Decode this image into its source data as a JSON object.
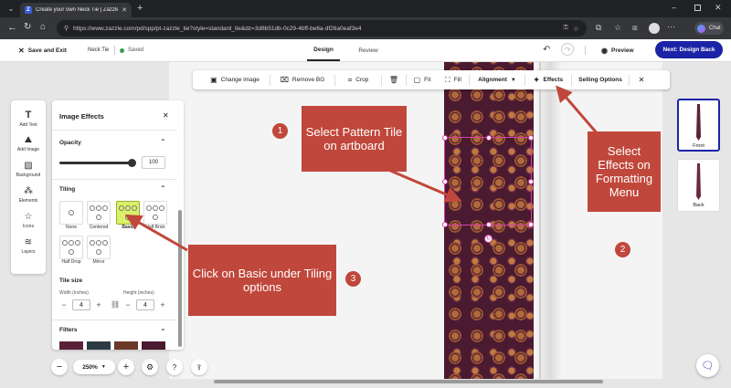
{
  "browser": {
    "tab_title": "Create your own Neck Tie | Zazzle",
    "url": "https://www.zazzle.com/pd/spp/pt-zazzle_tie?style=standard_tie&dz=3d8b51db-0c29-4bff-be6a-df26a0eaf3e4",
    "chat_label": "Chat"
  },
  "appbar": {
    "save_exit": "Save and Exit",
    "product": "Neck Tie",
    "saved": "Saved",
    "tab_design": "Design",
    "tab_review": "Review",
    "preview": "Preview",
    "next": "Next: Design Back"
  },
  "toolbar": {
    "change_image": "Change image",
    "remove_bg": "Remove BG",
    "crop": "Crop",
    "fit": "Fit",
    "fill": "Fill",
    "alignment": "Alignment",
    "effects": "Effects",
    "selling_options": "Selling Options"
  },
  "sidebar": {
    "items": [
      {
        "label": "Add Text"
      },
      {
        "label": "Add Image"
      },
      {
        "label": "Background"
      },
      {
        "label": "Elements"
      },
      {
        "label": "Icons"
      },
      {
        "label": "Layers"
      }
    ]
  },
  "panel": {
    "title": "Image Effects",
    "opacity_label": "Opacity",
    "opacity_value": "100",
    "opacity_level": 1.0,
    "tiling_label": "Tiling",
    "tiling_options": [
      {
        "label": "None"
      },
      {
        "label": "Centered"
      },
      {
        "label": "Basic"
      },
      {
        "label": "Half Brick"
      },
      {
        "label": "Half Drop"
      },
      {
        "label": "Mirror"
      }
    ],
    "tile_size_label": "Tile size",
    "width_label": "Width (inches)",
    "width_value": "4",
    "height_label": "Height (inches)",
    "height_value": "4",
    "filters_label": "Filters"
  },
  "zoom": {
    "value": "250%"
  },
  "views": [
    {
      "label": "Front"
    },
    {
      "label": "Back"
    }
  ],
  "callouts": {
    "one_text": "Select Pattern Tile on artboard",
    "one_num": "1",
    "two_text": "Select Effects on Formatting Menu",
    "two_num": "2",
    "three_text": "Click on Basic under Tiling options",
    "three_num": "3"
  },
  "colors": {
    "accent": "#1b23a6",
    "callout": "#c0473b",
    "selection": "#d63fa8",
    "tie_pattern": "#5a2238"
  }
}
